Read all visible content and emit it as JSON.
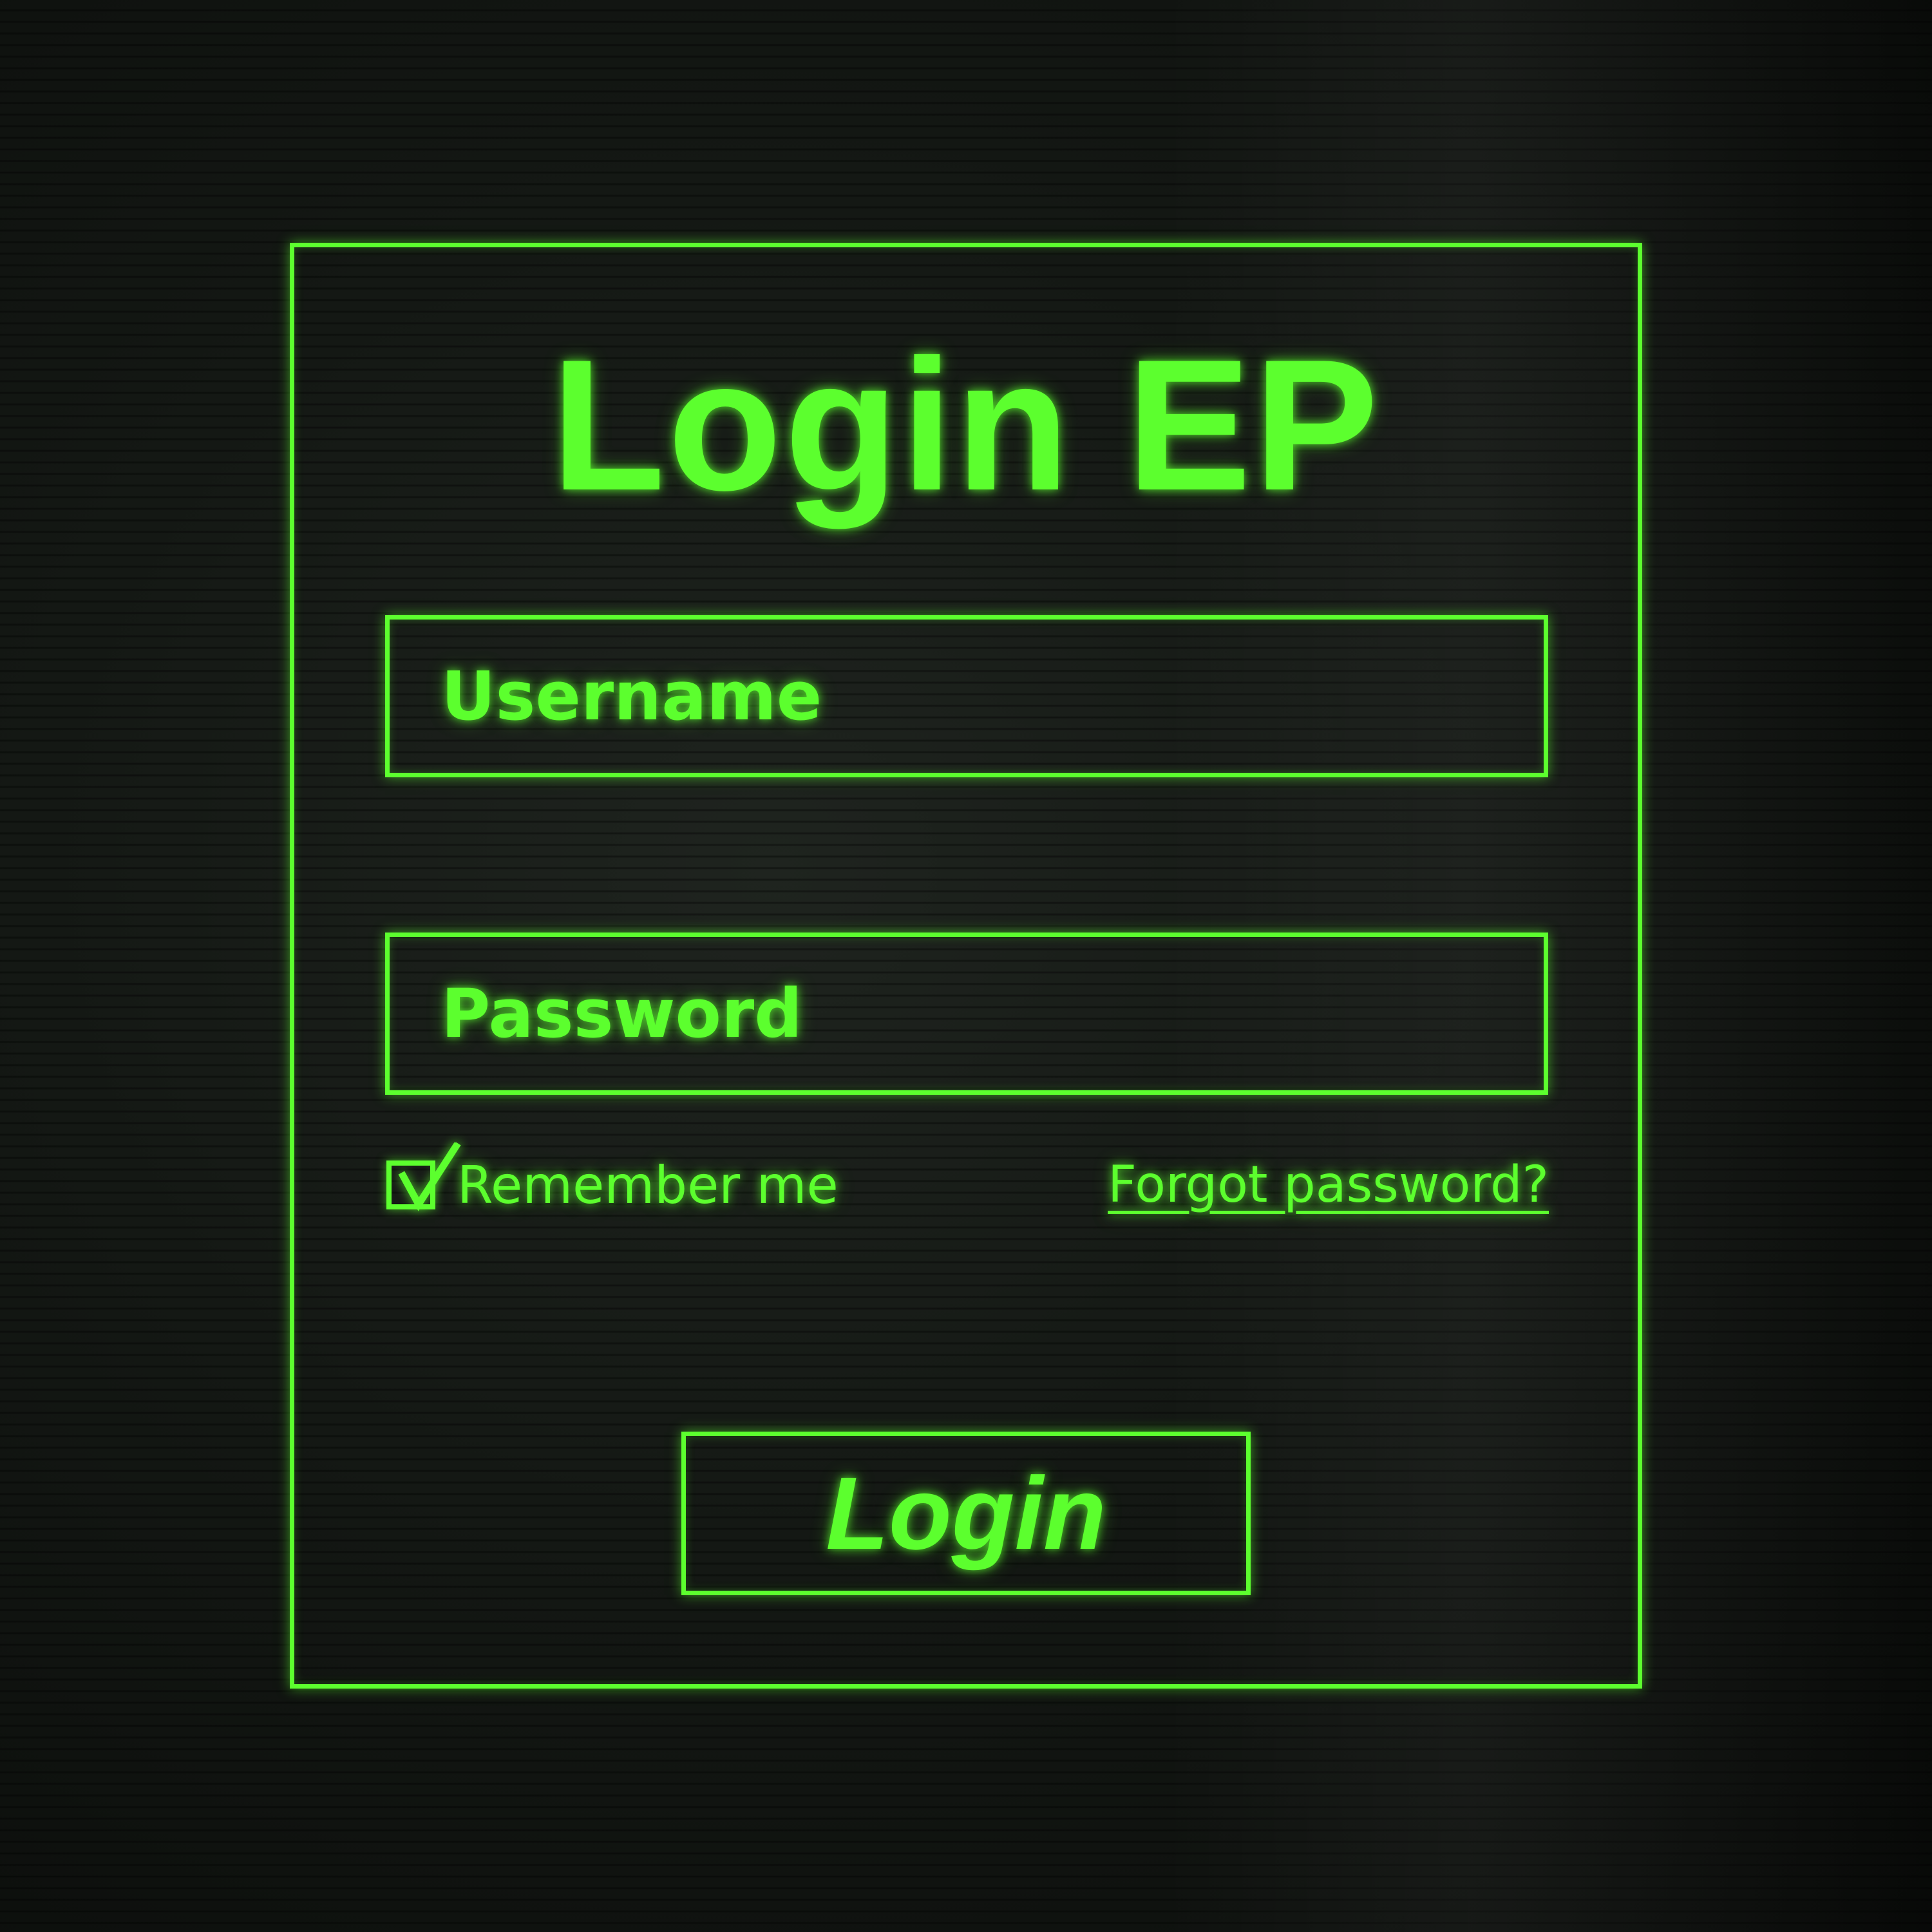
{
  "theme": {
    "accent": "#5cff2e",
    "background": "#141814"
  },
  "login_form": {
    "title": "Login EP",
    "username": {
      "placeholder": "Username",
      "value": ""
    },
    "password": {
      "placeholder": "Password",
      "value": ""
    },
    "remember_me": {
      "label": "Remember me",
      "checked": true
    },
    "forgot_password_label": "Forgot password?",
    "submit_label": "Login"
  }
}
